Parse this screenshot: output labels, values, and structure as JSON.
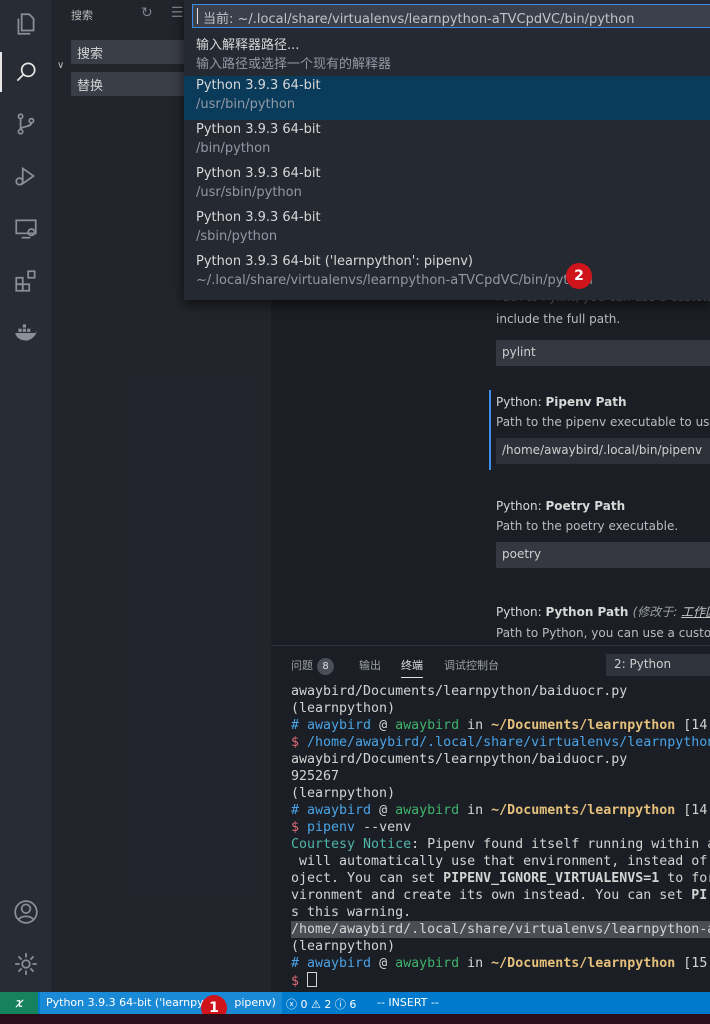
{
  "activity_bar": {
    "items": [
      {
        "name": "explorer-icon"
      },
      {
        "name": "search-icon"
      },
      {
        "name": "source-control-icon"
      },
      {
        "name": "run-debug-icon"
      },
      {
        "name": "remote-explorer-icon"
      },
      {
        "name": "extensions-icon"
      },
      {
        "name": "docker-icon"
      }
    ],
    "bottom": [
      {
        "name": "account-icon"
      },
      {
        "name": "settings-gear-icon"
      }
    ]
  },
  "sidebar": {
    "title": "搜索",
    "search_placeholder": "搜索",
    "replace_placeholder": "替换"
  },
  "quick_pick": {
    "input_text": "当前: ~/.local/share/virtualenvs/learnpython-aTVCpdVC/bin/python",
    "items": [
      {
        "line1": "输入解释器路径...",
        "line2": "输入路径或选择一个现有的解释器",
        "selected": false
      },
      {
        "line1": "Python 3.9.3 64-bit",
        "line2": "/usr/bin/python",
        "selected": true
      },
      {
        "line1": "Python 3.9.3 64-bit",
        "line2": "/bin/python",
        "selected": false
      },
      {
        "line1": "Python 3.9.3 64-bit",
        "line2": "/usr/sbin/python",
        "selected": false
      },
      {
        "line1": "Python 3.9.3 64-bit",
        "line2": "/sbin/python",
        "selected": false
      },
      {
        "line1": "Python 3.9.3 64-bit ('learnpython': pipenv)",
        "line2": "~/.local/share/virtualenvs/learnpython-aTVCpdVC/bin/python",
        "selected": false
      }
    ],
    "badge": "2"
  },
  "settings": {
    "pylint": {
      "desc_partial": "Path to Pylint, you can use a custom",
      "desc2": "include the full path.",
      "value": "pylint"
    },
    "pipenv": {
      "prefix": "Python: ",
      "name": "Pipenv Path",
      "desc": "Path to the pipenv executable to use f",
      "value": "/home/awaybird/.local/bin/pipenv"
    },
    "poetry": {
      "prefix": "Python: ",
      "name": "Poetry Path",
      "desc": "Path to the poetry executable.",
      "value": "poetry"
    },
    "python_path": {
      "prefix": "Python: ",
      "name": "Python Path",
      "modified_prefix": "(修改于: ",
      "modified_link": "工作区",
      "desc": "Path to Python, you can use a custom"
    }
  },
  "panel": {
    "tabs": [
      {
        "label": "问题",
        "count": "8"
      },
      {
        "label": "输出"
      },
      {
        "label": "终端",
        "active": true
      },
      {
        "label": "调试控制台"
      }
    ],
    "terminal_select": "2: Python",
    "terminal_lines": [
      {
        "segments": [
          {
            "t": "awaybird/Documents/learnpython/baiduocr.py"
          }
        ]
      },
      {
        "segments": [
          {
            "t": "(learnpython)"
          }
        ]
      },
      {
        "segments": [
          {
            "t": "# ",
            "c": "c-blue"
          },
          {
            "t": "awaybird",
            "c": "c-blue"
          },
          {
            "t": " @ "
          },
          {
            "t": "awaybird",
            "c": "c-green"
          },
          {
            "t": " in "
          },
          {
            "t": "~/Documents/learnpython",
            "c": "c-yellow"
          },
          {
            "t": " [14"
          }
        ]
      },
      {
        "segments": [
          {
            "t": "$ ",
            "c": "c-red"
          },
          {
            "t": "/home/awaybird/.local/share/virtualenvs/learnpython",
            "c": "c-blue"
          }
        ]
      },
      {
        "segments": [
          {
            "t": "awaybird/Documents/learnpython/baiduocr.py"
          }
        ]
      },
      {
        "segments": [
          {
            "t": "925267"
          }
        ]
      },
      {
        "segments": [
          {
            "t": "(learnpython)"
          }
        ]
      },
      {
        "segments": [
          {
            "t": "# ",
            "c": "c-blue"
          },
          {
            "t": "awaybird",
            "c": "c-blue"
          },
          {
            "t": " @ "
          },
          {
            "t": "awaybird",
            "c": "c-green"
          },
          {
            "t": " in "
          },
          {
            "t": "~/Documents/learnpython",
            "c": "c-yellow"
          },
          {
            "t": " [14"
          }
        ]
      },
      {
        "segments": [
          {
            "t": "$ ",
            "c": "c-red"
          },
          {
            "t": "pipenv",
            "c": "c-blue"
          },
          {
            "t": " --venv"
          }
        ]
      },
      {
        "segments": [
          {
            "t": "Courtesy Notice",
            "c": "c-teal"
          },
          {
            "t": ": Pipenv found itself running within a"
          }
        ]
      },
      {
        "segments": [
          {
            "t": " will automatically use that environment, instead of"
          }
        ]
      },
      {
        "segments": [
          {
            "t": "oject. You can set "
          },
          {
            "t": "PIPENV_IGNORE_VIRTUALENVS=1",
            "c": "c-b"
          },
          {
            "t": " to for"
          }
        ]
      },
      {
        "segments": [
          {
            "t": "vironment and create its own instead. You can set "
          },
          {
            "t": "PI",
            "c": "c-b"
          }
        ]
      },
      {
        "segments": [
          {
            "t": "s this warning."
          }
        ]
      },
      {
        "segments": [
          {
            "t": "/home/awaybird/.local/share/virtualenvs/learnpython-a"
          }
        ],
        "hl": true
      },
      {
        "segments": [
          {
            "t": "(learnpython)"
          }
        ]
      },
      {
        "segments": [
          {
            "t": "# ",
            "c": "c-blue"
          },
          {
            "t": "awaybird",
            "c": "c-blue"
          },
          {
            "t": " @ "
          },
          {
            "t": "awaybird",
            "c": "c-green"
          },
          {
            "t": " in "
          },
          {
            "t": "~/Documents/learnpython",
            "c": "c-yellow"
          },
          {
            "t": " [15"
          }
        ]
      },
      {
        "segments": [
          {
            "t": "$ ",
            "c": "c-red"
          }
        ],
        "cursor": true
      }
    ]
  },
  "status_bar": {
    "interpreter": "Python 3.9.3 64-bit ('learnpyth",
    "interpreter_tail": " pipenv)",
    "errors": "0",
    "warnings": "2",
    "infos": "6",
    "mode": "-- INSERT --",
    "badge": "1"
  }
}
